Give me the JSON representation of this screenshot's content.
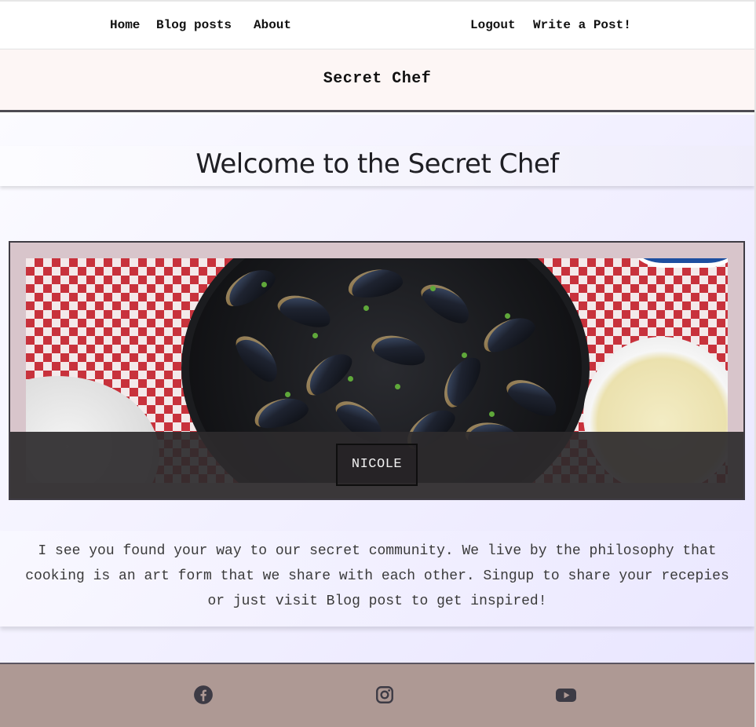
{
  "nav": {
    "left": [
      "Home",
      "Blog posts",
      "About"
    ],
    "right": [
      "Logout",
      "Write a Post!"
    ]
  },
  "brand": {
    "title": "Secret Chef"
  },
  "main": {
    "welcome_title": "Welcome to the Secret Chef",
    "hero": {
      "caption": "NICOLE"
    },
    "intro": "I see you found your way to our secret community. We live by the philosophy that cooking is an art form that we share with each other. Singup to share your recepies or just visit Blog post to get inspired!"
  },
  "footer": {
    "icons": [
      "facebook-icon",
      "instagram-icon",
      "youtube-icon"
    ]
  },
  "colors": {
    "nav_bg": "#ffffff",
    "brand_bg": "#fdf6f5",
    "hero_frame": "#d8c5cb",
    "footer_bg": "#ae9994",
    "icon_color": "#3d3b45"
  }
}
